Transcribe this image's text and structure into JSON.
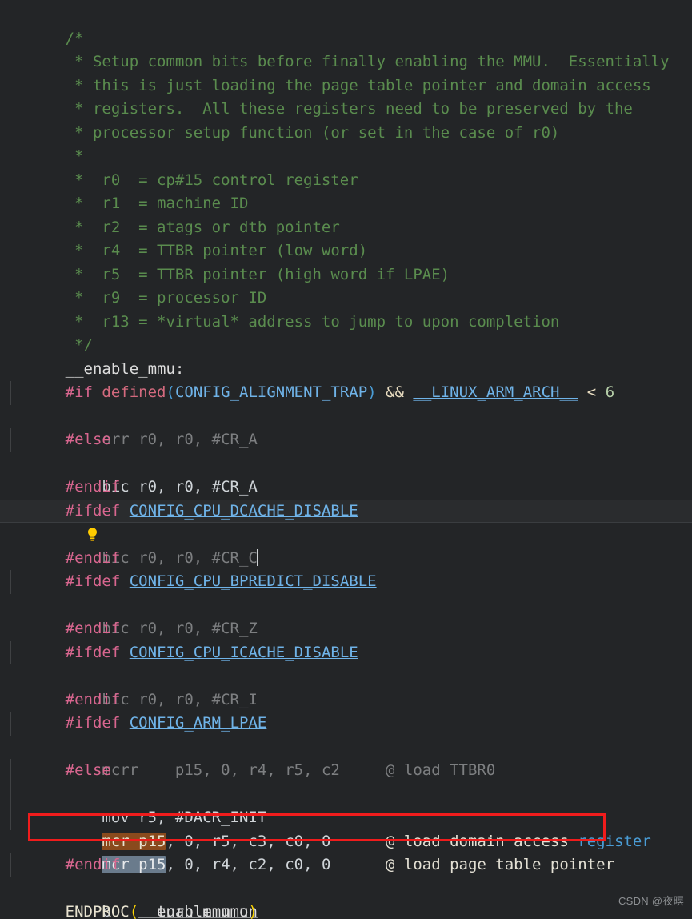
{
  "editor": {
    "background": "#232527",
    "font_size_px": 19,
    "line_height_px": 29.5
  },
  "colors": {
    "comment_green": "#5a8c4e",
    "preprocessor_pink": "#d8668f",
    "macro_blue": "#6fb3e8",
    "number_green": "#b5cea8",
    "plain_text": "#d4d4d4",
    "inactive_grey": "#7d7f81",
    "match_highlight_orange": "#8a4a1d",
    "selection_highlight_blue": "#6a7b8c",
    "annotation_red": "#f01c1c",
    "function_yellow": "#dcdcaa",
    "paren_yellow": "#ffd700"
  },
  "comment_block": {
    "open": "/*",
    "lines": [
      " * Setup common bits before finally enabling the MMU.  Essentially",
      " * this is just loading the page table pointer and domain access",
      " * registers.  All these registers need to be preserved by the",
      " * processor setup function (or set in the case of r0)",
      " *",
      " *  r0  = cp#15 control register",
      " *  r1  = machine ID",
      " *  r2  = atags or dtb pointer",
      " *  r4  = TTBR pointer (low word)",
      " *  r5  = TTBR pointer (high word if LPAE)",
      " *  r9  = processor ID",
      " *  r13 = *virtual* address to jump to upon completion"
    ],
    "close": " */"
  },
  "code": {
    "label_enable_mmu": "__enable_mmu:",
    "if_directive": "#if",
    "defined_keyword": "defined",
    "open_paren": "(",
    "config_alignment_trap": "CONFIG_ALIGNMENT_TRAP",
    "close_paren": ")",
    "and_operator": "&&",
    "linux_arm_arch": "__LINUX_ARM_ARCH__",
    "less_than": "<",
    "six": "6",
    "orr_cr_a": "orr r0, r0, #CR_A",
    "else_directive": "#else",
    "bic_cr_a": "bic r0, r0, #CR_A",
    "endif_directive": "#endif",
    "ifdef_directive": "#ifdef",
    "config_cpu_dcache_disable": "CONFIG_CPU_DCACHE_DISABLE",
    "bic_cr_c": "bic r0, r0, #CR_C",
    "config_cpu_bpredict_disable": "CONFIG_CPU_BPREDICT_DISABLE",
    "bic_cr_z": "bic r0, r0, #CR_Z",
    "config_cpu_icache_disable": "CONFIG_CPU_ICACHE_DISABLE",
    "bic_cr_i": "bic r0, r0, #CR_I",
    "config_arm_lpae": "CONFIG_ARM_LPAE",
    "mcrr_line": "mcrr    p15, 0, r4, r5, c2",
    "mcrr_comment": "@ load TTBR0",
    "mov_dacr": "mov r5, #DACR_INIT",
    "mcr_match_text": "mcr p15",
    "mcr_domain_rest": ", 0, r5, c3, c0, 0",
    "mcr_domain_comment_prefix": "@ load domain access ",
    "mcr_domain_comment_keyword": "register",
    "mcr_ttbr_rest": ", 0, r4, c2, c0, 0",
    "mcr_ttbr_comment": "@ load page table pointer",
    "branch_instruction": "b",
    "branch_target": "__turn_mmu_on",
    "endproc_name": "ENDPROC",
    "endproc_open": "(",
    "endproc_arg": "__enable_mmu",
    "endproc_close": ")"
  },
  "annotations": {
    "red_box_label": "highlighted page-table-pointer line",
    "lightbulb_label": "quick-fix lightbulb"
  },
  "watermark": {
    "text": "CSDN @夜暝"
  }
}
